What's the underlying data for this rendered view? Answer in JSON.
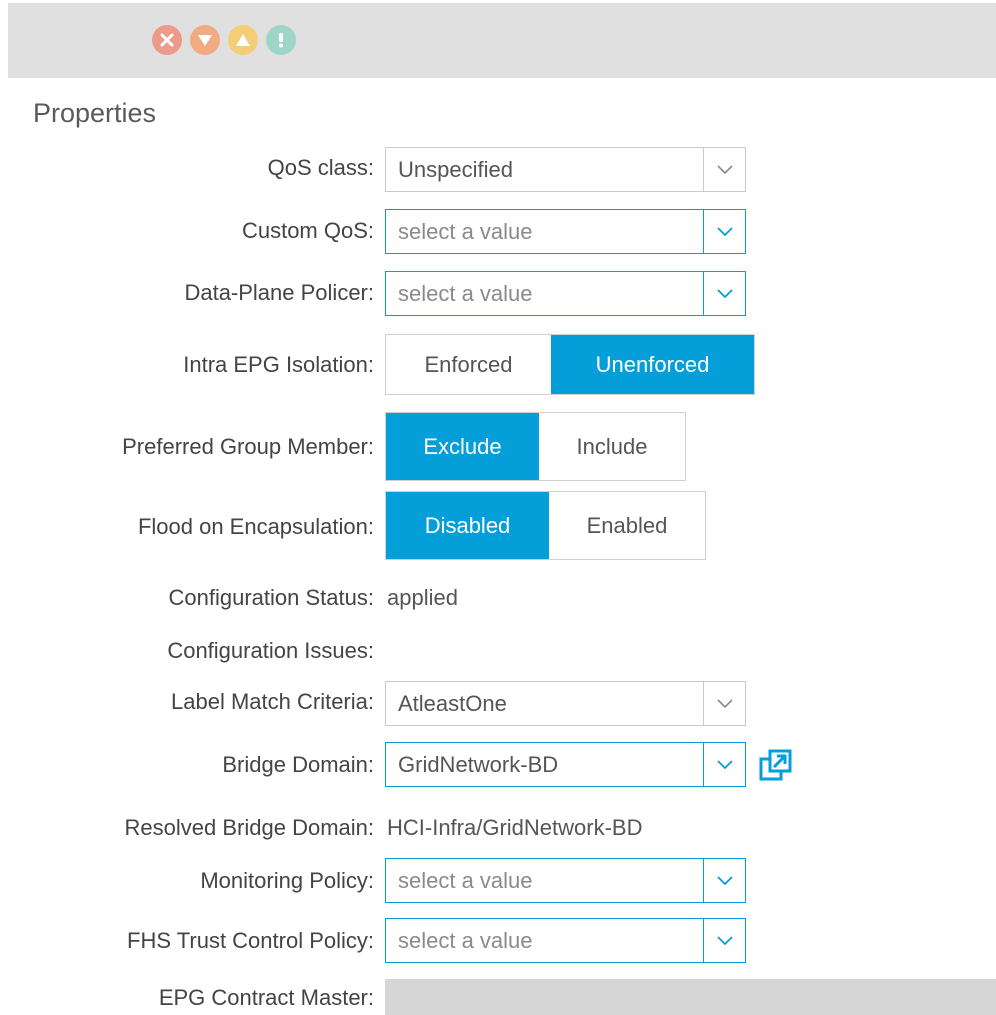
{
  "fault_bar": {
    "icons": [
      {
        "name": "critical-icon",
        "glyph": "✕",
        "color": "#ec9a8a"
      },
      {
        "name": "major-icon",
        "glyph": "▼",
        "color": "#f1ab82"
      },
      {
        "name": "minor-icon",
        "glyph": "▲",
        "color": "#f4cd77"
      },
      {
        "name": "warning-icon",
        "glyph": "!",
        "color": "#9dd6c7"
      }
    ]
  },
  "properties": {
    "title": "Properties",
    "accent_color": "#049fd9",
    "qos_class": {
      "label": "QoS class:",
      "value": "Unspecified"
    },
    "custom_qos": {
      "label": "Custom QoS:",
      "placeholder": "select a value"
    },
    "data_plane_policer": {
      "label": "Data-Plane Policer:",
      "placeholder": "select a value"
    },
    "intra_epg_isolation": {
      "label": "Intra EPG Isolation:",
      "options": [
        "Enforced",
        "Unenforced"
      ],
      "selected": "Unenforced"
    },
    "preferred_group_member": {
      "label": "Preferred Group Member:",
      "options": [
        "Exclude",
        "Include"
      ],
      "selected": "Exclude"
    },
    "flood_on_encapsulation": {
      "label": "Flood on Encapsulation:",
      "options": [
        "Disabled",
        "Enabled"
      ],
      "selected": "Disabled"
    },
    "configuration_status": {
      "label": "Configuration Status:",
      "value": "applied"
    },
    "configuration_issues": {
      "label": "Configuration Issues:",
      "value": ""
    },
    "label_match_criteria": {
      "label": "Label Match Criteria:",
      "value": "AtleastOne"
    },
    "bridge_domain": {
      "label": "Bridge Domain:",
      "value": "GridNetwork-BD",
      "link_icon": "external-link-icon"
    },
    "resolved_bridge_domain": {
      "label": "Resolved Bridge Domain:",
      "value": "HCI-Infra/GridNetwork-BD"
    },
    "monitoring_policy": {
      "label": "Monitoring Policy:",
      "placeholder": "select a value"
    },
    "fhs_trust_control_policy": {
      "label": "FHS Trust Control Policy:",
      "placeholder": "select a value"
    },
    "epg_contract_master": {
      "label": "EPG Contract Master:"
    }
  }
}
